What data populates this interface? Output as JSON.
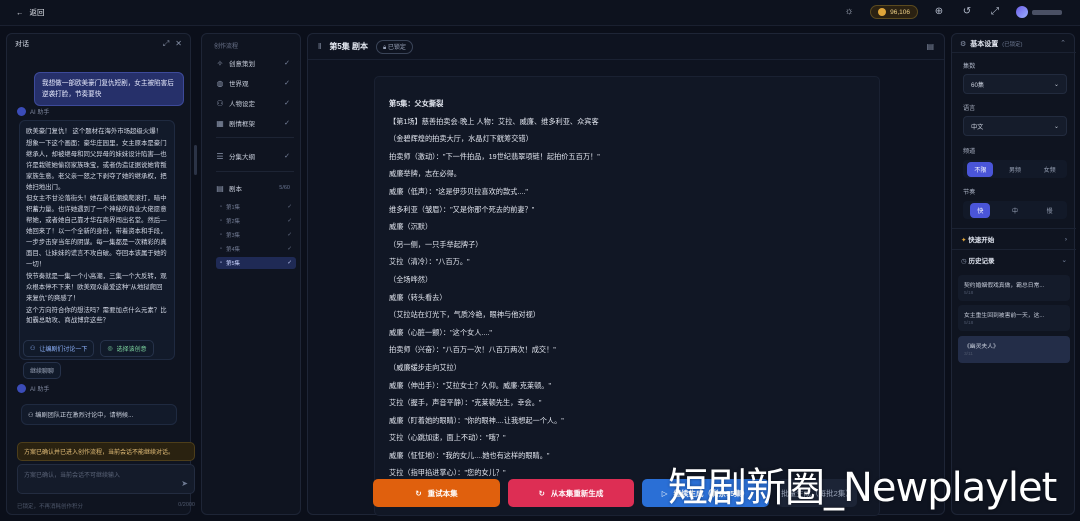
{
  "topbar": {
    "back_label": "返回",
    "credits": "96,106"
  },
  "chat": {
    "title": "对话",
    "user_message": "我想做一部欧美豪门复仇短剧，女主被陷害后逆袭打脸，节奏要快",
    "ai_name": "AI 助手",
    "ai_paragraphs": [
      "欧美豪门复仇！ 这个题材在海外市场超级火爆！",
      "想象一下这个画面：豪华庄园里，女主原本是豪门继承人，却被继母和同父异母的妹妹设计陷害—也许是栽赃她偷窃家族珠宝，或者伪造证据说她背叛家族生意。老父亲一怒之下剥夺了她的继承权，把她扫地出门。",
      "但女主不甘沦落街头！她在最低潮摸爬滚打，暗中积蓄力量。也许她遇到了一个神秘的商业大佬愿意帮她，或者她自己靠才华在商界闯出名堂。然后—她回来了！以一个全新的身份，带着资本和手段，一步步击穿当年的阴谋。每一集都是一次精彩的真面目、让妹妹的谎言不攻自破。夺回本该属于她的一切！",
      "快节奏就是一集一个小高潮，三集一个大反转，观众根本停不下来！欧美观众最爱这种\"从地狱爬回来复仇\"的爽感了！",
      "这个方向符合你的想法吗？需要加点什么元素？比如霸总助攻、商战博弈这些？"
    ],
    "chip_discuss": "让编剧们讨论一下",
    "chip_choose": "选择该创意",
    "chip_continue": "继续聊聊",
    "ai_name2": "AI 助手",
    "team_msg": "编剧团队正在激烈讨论中，请稍候...",
    "warning": "方案已确认并已进入创作流程，当前会话不能继续对话。",
    "input_placeholder": "方案已确认，当前会话不可继续输入",
    "footer_left": "已锁定，不再消耗创作积分",
    "footer_right": "0/2000"
  },
  "workflow": {
    "title": "创作流程",
    "steps": [
      {
        "label": "创意策划"
      },
      {
        "label": "世界观"
      },
      {
        "label": "人物设定"
      },
      {
        "label": "剧情框架"
      },
      {
        "label": "分集大纲"
      }
    ],
    "script_label": "剧本",
    "script_count": "5/60",
    "episodes": [
      "第1集",
      "第2集",
      "第3集",
      "第4集",
      "第5集"
    ]
  },
  "editor": {
    "title": "第5集 剧本",
    "badge": "已锁定",
    "lines": [
      "第5集：父女撕裂",
      "【第1场】慈善拍卖会·晚上 人物：艾拉、威廉、维多利亚、众宾客",
      "（金碧辉煌的拍卖大厅，水晶灯下觥筹交错）",
      "拍卖师（激动）：\"下一件拍品，19世纪翡翠项链！起拍价五百万！\"",
      "威廉举牌，志在必得。",
      "威廉（低声）：\"这是伊莎贝拉喜欢的款式....\"",
      "维多利亚（皱眉）：\"又是你那个死去的前妻？\"",
      "威廉（沉默）",
      "（另一侧，一只手举起牌子）",
      "艾拉（清冷）：\"八百万。\"",
      "（全场哗然）",
      "威廉（转头看去）",
      "（艾拉站在灯光下，气质冷艳，眼神与他对视）",
      "威廉（心脏一颤）：\"这个女人....\"",
      "拍卖师（兴奋）：\"八百万一次！八百万两次！成交！\"",
      "（威廉缓步走向艾拉）",
      "威廉（伸出手）：\"艾拉女士？久仰。威廉·克莱顿。\"",
      "艾拉（握手，声音平静）：\"克莱顿先生，幸会。\"",
      "威廉（盯着她的眼睛）：\"你的眼神....让我想起一个人。\"",
      "艾拉（心跳加速，面上不动）：\"哦？\"",
      "威廉（怔怔地）：\"我的女儿....她也有这样的眼睛。\"",
      "艾拉（指甲掐进掌心）：\"您的女儿？\""
    ],
    "btn_retry": "重试本集",
    "btn_regen": "从本集重新生成",
    "btn_continue": "继续生成（剩余55集）",
    "btn_batch": "批量生成（每批2集）"
  },
  "settings": {
    "title": "基本设置",
    "status": "(已锁定)",
    "episodes_label": "集数",
    "episodes_value": "60集",
    "language_label": "语言",
    "language_value": "中文",
    "channel_label": "频道",
    "channel_options": [
      "不限",
      "男频",
      "女频"
    ],
    "pace_label": "节奏",
    "pace_options": [
      "快",
      "中",
      "慢"
    ],
    "quick_start": "快速开始",
    "history_title": "历史记录",
    "history": [
      {
        "title": "契约婚姻假戏真做，霸总日常...",
        "time": "5/18"
      },
      {
        "title": "女主重生回到被害前一天，这...",
        "time": "5/18"
      },
      {
        "title": "《幽灵夫人》",
        "time": "3/11"
      }
    ]
  },
  "watermark": "短剧新圈_Newplaylet"
}
